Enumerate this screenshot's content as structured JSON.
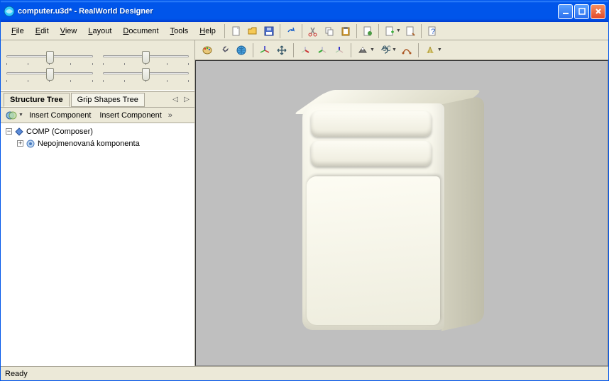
{
  "window": {
    "title": "computer.u3d* - RealWorld Designer"
  },
  "menus": {
    "file": "File",
    "edit": "Edit",
    "view": "View",
    "layout": "Layout",
    "document": "Document",
    "tools": "Tools",
    "help": "Help"
  },
  "left": {
    "tabs": {
      "structure": "Structure Tree",
      "grip": "Grip Shapes Tree"
    },
    "commands": {
      "insert1": "Insert Component",
      "insert2": "Insert Component"
    },
    "tree": {
      "root": "COMP (Composer)",
      "child": "Nepojmenovaná komponenta"
    }
  },
  "status": {
    "text": "Ready"
  }
}
